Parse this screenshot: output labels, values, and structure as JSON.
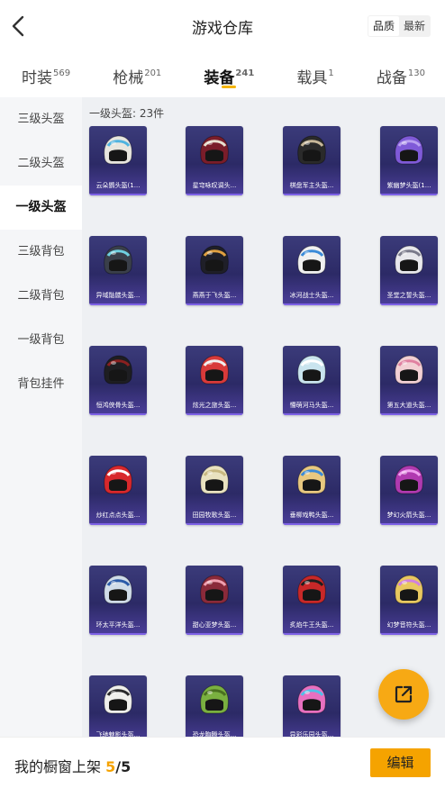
{
  "header": {
    "title": "游戏仓库",
    "sort_options": [
      "品质",
      "最新"
    ]
  },
  "tabs": [
    {
      "label": "时装",
      "count": "569"
    },
    {
      "label": "枪械",
      "count": "201"
    },
    {
      "label": "装备",
      "count": "241"
    },
    {
      "label": "载具",
      "count": "1"
    },
    {
      "label": "战备",
      "count": "130"
    }
  ],
  "sidebar": {
    "items": [
      "三级头盔",
      "二级头盔",
      "一级头盔",
      "三级背包",
      "二级背包",
      "一级背包",
      "背包挂件"
    ]
  },
  "main": {
    "section_title": "一级头盔: 23件",
    "items": [
      {
        "name": "云朵鹦头盔(1...",
        "color": "#e8e6df",
        "accent": "#4fb3e0"
      },
      {
        "name": "星穹咏叹调头...",
        "color": "#7a1d2a",
        "accent": "#e8e0d0"
      },
      {
        "name": "棋盘军主头盔...",
        "color": "#2a2a2a",
        "accent": "#c8b89a"
      },
      {
        "name": "紫幽梦头盔(1...",
        "color": "#7f5ad8",
        "accent": "#b9a0f0"
      },
      {
        "name": "异域骷髅头盔...",
        "color": "#3a3f4a",
        "accent": "#6fd0e0"
      },
      {
        "name": "燕燕于飞头盔...",
        "color": "#1f1f28",
        "accent": "#e0a040"
      },
      {
        "name": "冰河战士头盔...",
        "color": "#f0f0f0",
        "accent": "#3a8ad8"
      },
      {
        "name": "圣堂之誓头盔...",
        "color": "#e8e8ec",
        "accent": "#7a7a8a"
      },
      {
        "name": "恒鸿侠骨头盔...",
        "color": "#1e1e22",
        "accent": "#8a2020"
      },
      {
        "name": "炫光之旅头盔...",
        "color": "#d83a3a",
        "accent": "#f0f0f0"
      },
      {
        "name": "懵萌河马头盔...",
        "color": "#c9e4ee",
        "accent": "#ffffff"
      },
      {
        "name": "第五大道头盔...",
        "color": "#f2d0d4",
        "accent": "#e080a0"
      },
      {
        "name": "炒红点点头盔...",
        "color": "#d8282c",
        "accent": "#ffffff"
      },
      {
        "name": "田园牧歌头盔...",
        "color": "#e9e2c0",
        "accent": "#c8b880"
      },
      {
        "name": "垂柳戏鸭头盔...",
        "color": "#e8c880",
        "accent": "#3a8ad8"
      },
      {
        "name": "梦幻火箭头盔...",
        "color": "#b03ab0",
        "accent": "#f0a0f0"
      },
      {
        "name": "环太平洋头盔...",
        "color": "#d0dce8",
        "accent": "#2a5aa8"
      },
      {
        "name": "甜心亚梦头盔...",
        "color": "#8a2a3a",
        "accent": "#f0a0b0"
      },
      {
        "name": "炙焰牛王头盔...",
        "color": "#c82828",
        "accent": "#1e1e1e"
      },
      {
        "name": "幻梦音符头盔...",
        "color": "#e8c860",
        "accent": "#d080e0"
      },
      {
        "name": "飞驰魅影头盔...",
        "color": "#f0f0ec",
        "accent": "#2a2a2a"
      },
      {
        "name": "恐龙胸腾头盔...",
        "color": "#7ab040",
        "accent": "#4a7020"
      },
      {
        "name": "异彩乐园头盔...",
        "color": "#e870c0",
        "accent": "#50c0e8"
      }
    ]
  },
  "footer": {
    "label": "我的橱窗上架",
    "current": "5",
    "separator": "/",
    "total": "5",
    "edit_label": "编辑"
  },
  "colors": {
    "accent": "#f5a300",
    "card_bg": "#2c2a66",
    "sidebar_bg": "#f5f6f8",
    "main_bg": "#eef0f3"
  },
  "icons": {
    "back": "chevron-left-icon",
    "share": "share-icon"
  }
}
